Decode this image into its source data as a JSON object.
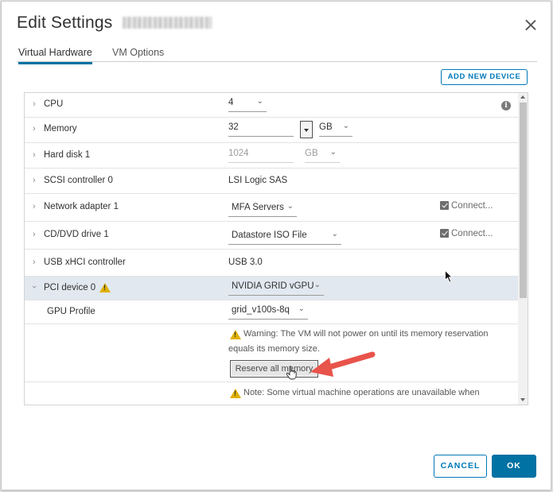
{
  "dialog": {
    "title": "Edit Settings",
    "vm_name_redacted": ""
  },
  "tabs": [
    {
      "label": "Virtual Hardware",
      "active": true
    },
    {
      "label": "VM Options",
      "active": false
    }
  ],
  "toolbar": {
    "add_device_label": "ADD NEW DEVICE"
  },
  "hardware": {
    "cpu": {
      "label": "CPU",
      "value": "4"
    },
    "memory": {
      "label": "Memory",
      "value": "32",
      "unit": "GB"
    },
    "hard_disk": {
      "label": "Hard disk 1",
      "value": "1024",
      "unit": "GB"
    },
    "scsi": {
      "label": "SCSI controller 0",
      "value": "LSI Logic SAS"
    },
    "network": {
      "label": "Network adapter 1",
      "value": "MFA Servers",
      "connect_label": "Connect..."
    },
    "cdrom": {
      "label": "CD/DVD drive 1",
      "value": "Datastore ISO File",
      "connect_label": "Connect..."
    },
    "usb": {
      "label": "USB xHCI controller",
      "value": "USB 3.0"
    },
    "pci": {
      "label": "PCI device 0",
      "value": "NVIDIA GRID vGPU"
    },
    "gpu_profile": {
      "label": "GPU Profile",
      "value": "grid_v100s-8q"
    },
    "warning": {
      "line1": "Warning: The VM will not power on until its memory reservation",
      "line2": "equals its memory size.",
      "reserve_label": "Reserve all memory"
    },
    "note": {
      "text": "Note: Some virtual machine operations are unavailable when"
    }
  },
  "footer": {
    "cancel_label": "CANCEL",
    "ok_label": "OK"
  },
  "colors": {
    "accent": "#0072a3",
    "warning": "#e0b000",
    "annotation_arrow": "#e8534a",
    "selected_row": "#e1e8f0"
  },
  "icons": {
    "close": "close-icon",
    "info": "info-icon",
    "warning": "warning-icon",
    "chevron": "chevron-right-icon"
  }
}
